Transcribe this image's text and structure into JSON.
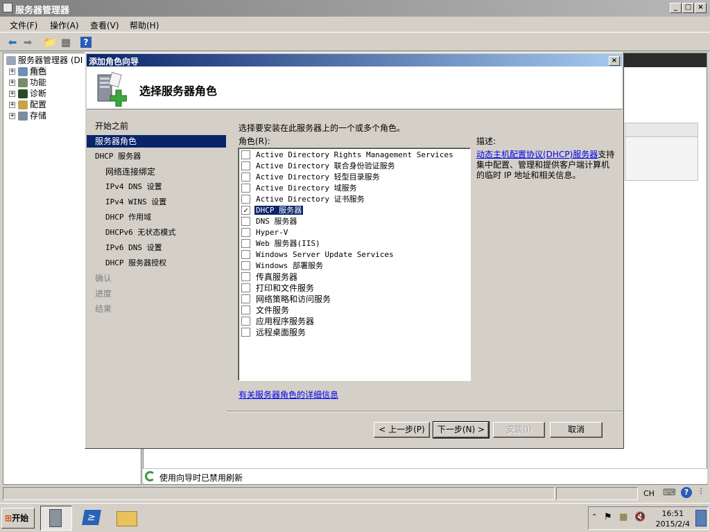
{
  "main": {
    "title": "服务器管理器",
    "menu": [
      "文件(F)",
      "操作(A)",
      "查看(V)",
      "帮助(H)"
    ],
    "tree": [
      {
        "label": "服务器管理器 (DI",
        "level": 0
      },
      {
        "label": "角色",
        "level": 1
      },
      {
        "label": "功能",
        "level": 1
      },
      {
        "label": "诊断",
        "level": 1
      },
      {
        "label": "配置",
        "level": 1
      },
      {
        "label": "存储",
        "level": 1
      }
    ],
    "status_text": "使用向导时已禁用刷新"
  },
  "dialog": {
    "title": "添加角色向导",
    "heading": "选择服务器角色",
    "steps": [
      {
        "label": "开始之前",
        "state": "normal"
      },
      {
        "label": "服务器角色",
        "state": "active"
      },
      {
        "label": "DHCP 服务器",
        "state": "normal"
      },
      {
        "label": "网络连接绑定",
        "state": "sub"
      },
      {
        "label": "IPv4 DNS 设置",
        "state": "sub"
      },
      {
        "label": "IPv4 WINS 设置",
        "state": "sub"
      },
      {
        "label": "DHCP 作用域",
        "state": "sub"
      },
      {
        "label": "DHCPv6 无状态模式",
        "state": "sub"
      },
      {
        "label": "IPv6 DNS 设置",
        "state": "sub"
      },
      {
        "label": "DHCP 服务器授权",
        "state": "sub"
      },
      {
        "label": "确认",
        "state": "disabled"
      },
      {
        "label": "进度",
        "state": "disabled"
      },
      {
        "label": "结果",
        "state": "disabled"
      }
    ],
    "instruction": "选择要安装在此服务器上的一个或多个角色。",
    "roles_label": "角色(R):",
    "roles": [
      {
        "label": "Active Directory Rights Management Services",
        "checked": false
      },
      {
        "label": "Active Directory 联合身份验证服务",
        "checked": false
      },
      {
        "label": "Active Directory 轻型目录服务",
        "checked": false
      },
      {
        "label": "Active Directory 域服务",
        "checked": false
      },
      {
        "label": "Active Directory 证书服务",
        "checked": false
      },
      {
        "label": "DHCP 服务器",
        "checked": true,
        "selected": true
      },
      {
        "label": "DNS 服务器",
        "checked": false
      },
      {
        "label": "Hyper-V",
        "checked": false
      },
      {
        "label": "Web 服务器(IIS)",
        "checked": false
      },
      {
        "label": "Windows Server Update Services",
        "checked": false
      },
      {
        "label": "Windows 部署服务",
        "checked": false
      },
      {
        "label": "传真服务器",
        "checked": false
      },
      {
        "label": "打印和文件服务",
        "checked": false
      },
      {
        "label": "网络策略和访问服务",
        "checked": false
      },
      {
        "label": "文件服务",
        "checked": false
      },
      {
        "label": "应用程序服务器",
        "checked": false
      },
      {
        "label": "远程桌面服务",
        "checked": false
      }
    ],
    "more_info_link": "有关服务器角色的详细信息",
    "description_label": "描述:",
    "description_link": "动态主机配置协议(DHCP)服务器",
    "description_text": "支持集中配置、管理和提供客户端计算机的临时 IP 地址和相关信息。",
    "buttons": {
      "back": "< 上一步(P)",
      "next": "下一步(N) >",
      "install": "安装(I)",
      "cancel": "取消"
    }
  },
  "statusbar": {
    "lang": "CH"
  },
  "taskbar": {
    "start": "开始",
    "time": "16:51",
    "date": "2015/2/4"
  }
}
